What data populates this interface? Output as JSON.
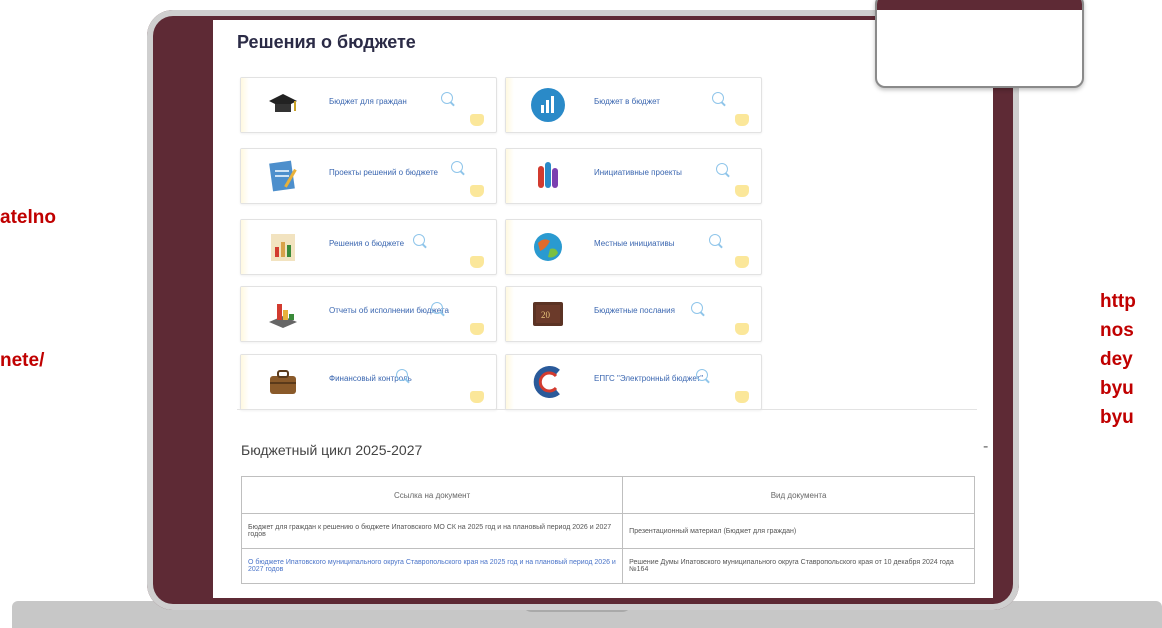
{
  "side_text": {
    "left_line1": "atelno",
    "left_line2": "nete/",
    "right_lines": [
      "http",
      "nos",
      "dey",
      "byu",
      "byu"
    ]
  },
  "page": {
    "title": "Решения о бюджете",
    "tiles": [
      {
        "label": "Бюджет для граждан",
        "icon": "graduation-cap-icon",
        "color": "#222222"
      },
      {
        "label": "Бюджет в бюджет",
        "icon": "bar-chart-icon",
        "color": "#2a8ac8"
      },
      {
        "label": "Проекты решений о бюджете",
        "icon": "document-pencil-icon",
        "color": "#4d8fcc"
      },
      {
        "label": "Инициативные проекты",
        "icon": "raised-hands-icon",
        "color": "#d23b2f"
      },
      {
        "label": "Решения о бюджете",
        "icon": "report-chart-icon",
        "color": "#d8a24a"
      },
      {
        "label": "Местные инициативы",
        "icon": "globe-icon",
        "color": "#e06a2b"
      },
      {
        "label": "Отчеты об исполнении бюджета",
        "icon": "stacked-chart-icon",
        "color": "#9a6a3a"
      },
      {
        "label": "Бюджетные послания",
        "icon": "book-icon",
        "color": "#6b3a2a"
      },
      {
        "label": "Финансовый контроль",
        "icon": "briefcase-icon",
        "color": "#8a5a2a"
      },
      {
        "label": "ЕПГС \"Электронный бюджет\"",
        "icon": "e-budget-logo-icon",
        "color": "#2a5a9a"
      }
    ],
    "cycle": {
      "title": "Бюджетный цикл 2025-2027",
      "toggle": "-"
    },
    "table": {
      "headers": [
        "Ссылка на документ",
        "Вид документа"
      ],
      "rows": [
        {
          "link": "Бюджет для граждан к решению о бюджете Ипатовского МО СК на 2025 год и на плановый период 2026 и 2027 годов",
          "type": "Презентационный материал (Бюджет для граждан)"
        },
        {
          "link": "О бюджете Ипатовского муниципального округа Ставропольского края на 2025 год и на плановый период 2026 и 2027 годов",
          "type": "Решение Думы Ипатовского муниципального округа Ставропольского края от 10 декабря 2024 года №164"
        }
      ]
    }
  },
  "colors": {
    "laptop_lid": "#5e2a35",
    "side_text": "#c00000",
    "link": "#3a66b0"
  }
}
